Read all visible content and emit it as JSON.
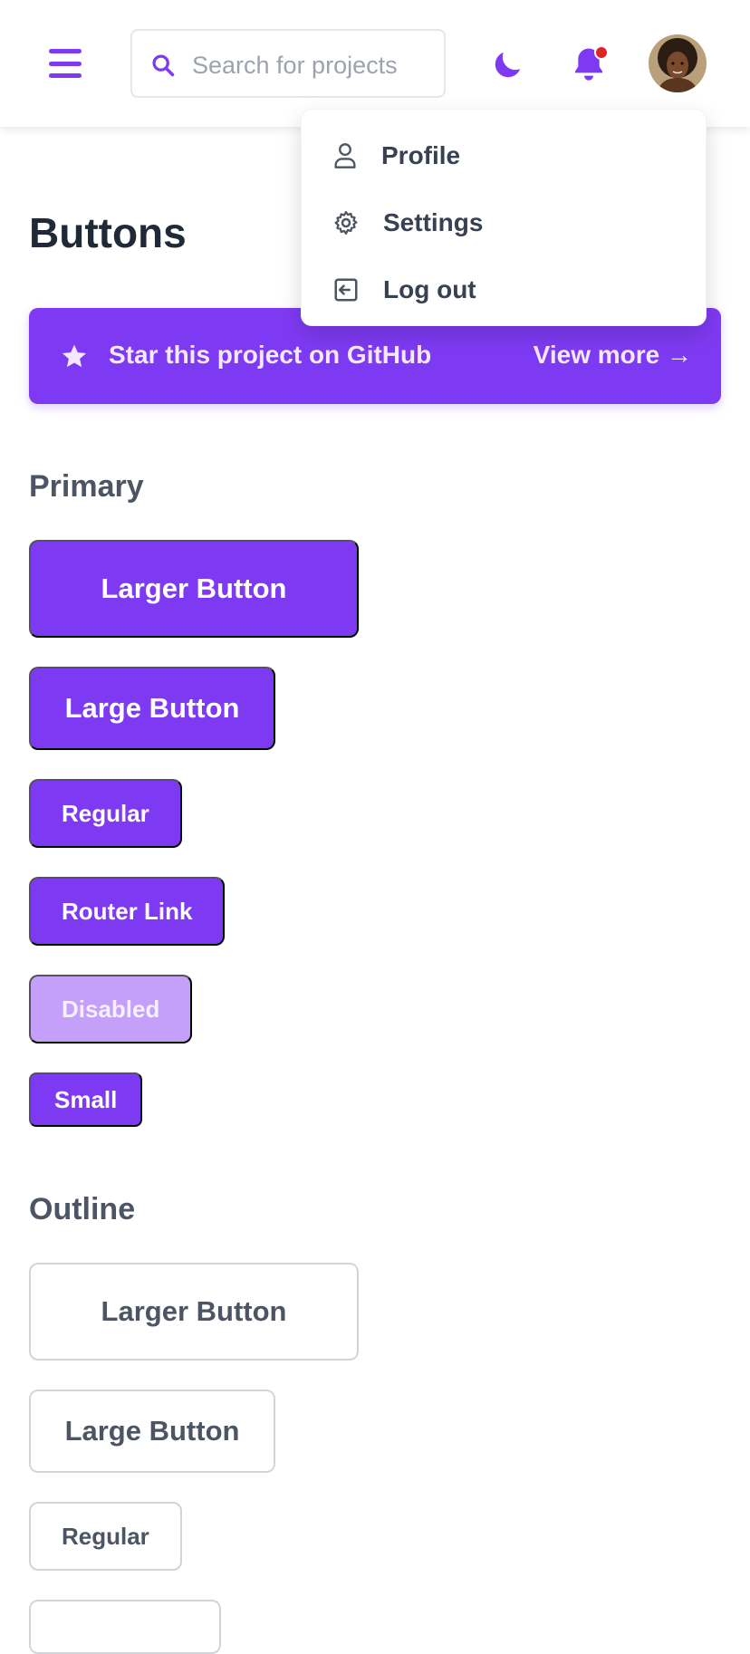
{
  "header": {
    "search_placeholder": "Search for projects",
    "icons": [
      "menu-icon",
      "search-icon",
      "moon-icon",
      "bell-icon",
      "avatar"
    ],
    "accent_color": "#7e3af2",
    "notification_dot_color": "#dc2626"
  },
  "profile_menu": {
    "items": [
      {
        "label": "Profile",
        "icon": "user-icon"
      },
      {
        "label": "Settings",
        "icon": "gear-icon"
      },
      {
        "label": "Log out",
        "icon": "logout-icon"
      }
    ]
  },
  "page": {
    "title": "Buttons"
  },
  "banner": {
    "text": "Star this project on GitHub",
    "link": "View more →",
    "icon": "star-icon"
  },
  "primary": {
    "title": "Primary",
    "larger": "Larger Button",
    "large": "Large Button",
    "regular": "Regular",
    "router_link": "Router Link",
    "disabled": "Disabled",
    "small": "Small"
  },
  "outline": {
    "title": "Outline",
    "larger": "Larger Button",
    "large": "Large Button",
    "regular": "Regular"
  }
}
